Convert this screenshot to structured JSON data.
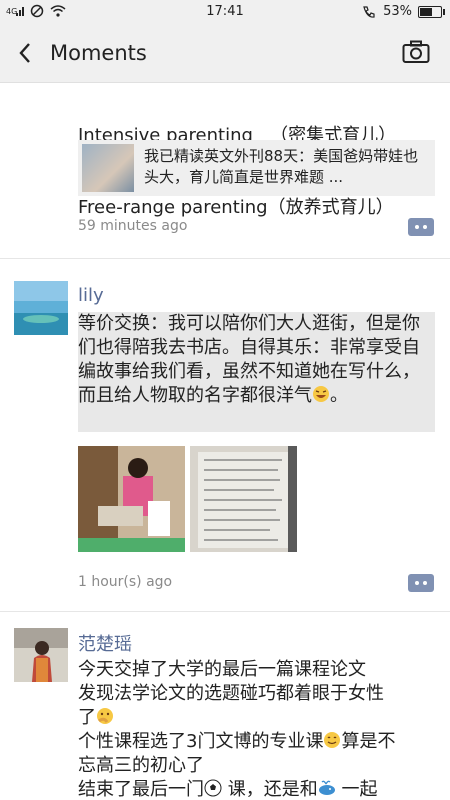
{
  "status_bar": {
    "left_icons": [
      "4G signal-icon",
      "do-not-disturb-icon",
      "wifi-icon"
    ],
    "time": "17:41",
    "battery": "53%",
    "battery_level": 0.53,
    "right_icons": [
      "phone-wifi-icon",
      "battery-icon"
    ]
  },
  "nav": {
    "title": "Moments",
    "back_icon": "chevron-left-icon",
    "camera_icon": "camera-icon"
  },
  "posts": [
    {
      "text_lines": [
        "Intensive parenting   （密集式育儿）",
        "Free-range parenting（放养式育儿）"
      ],
      "share": {
        "title": "我已精读英文外刊88天：美国爸妈带娃也头大，育儿简直是世界难题 ..."
      },
      "time": "59 minutes ago"
    },
    {
      "user": "lily",
      "text": "等价交换：我可以陪你们大人逛街，但是你们也得陪我去书店。自得其乐：非常享受自编故事给我们看，虽然不知道她在写什么，而且给人物取的名字都很洋气",
      "text_end": "。",
      "time": "1 hour(s) ago"
    },
    {
      "user": "范楚瑶",
      "lines": [
        "今天交掉了大学的最后一篇课程论文",
        "发现法学论文的选题碰巧都着眼于女性",
        "了",
        "个性课程选了3门文博的专业课",
        "算是不",
        "忘高三的初心了",
        "结束了最后一门",
        " 课，还是和",
        " 一起"
      ]
    }
  ],
  "colors": {
    "username": "#576b95",
    "comment_button": "#8091b3",
    "timestamp": "#8a8a8a",
    "background": "#ffffff",
    "header": "#f0f0f0"
  }
}
